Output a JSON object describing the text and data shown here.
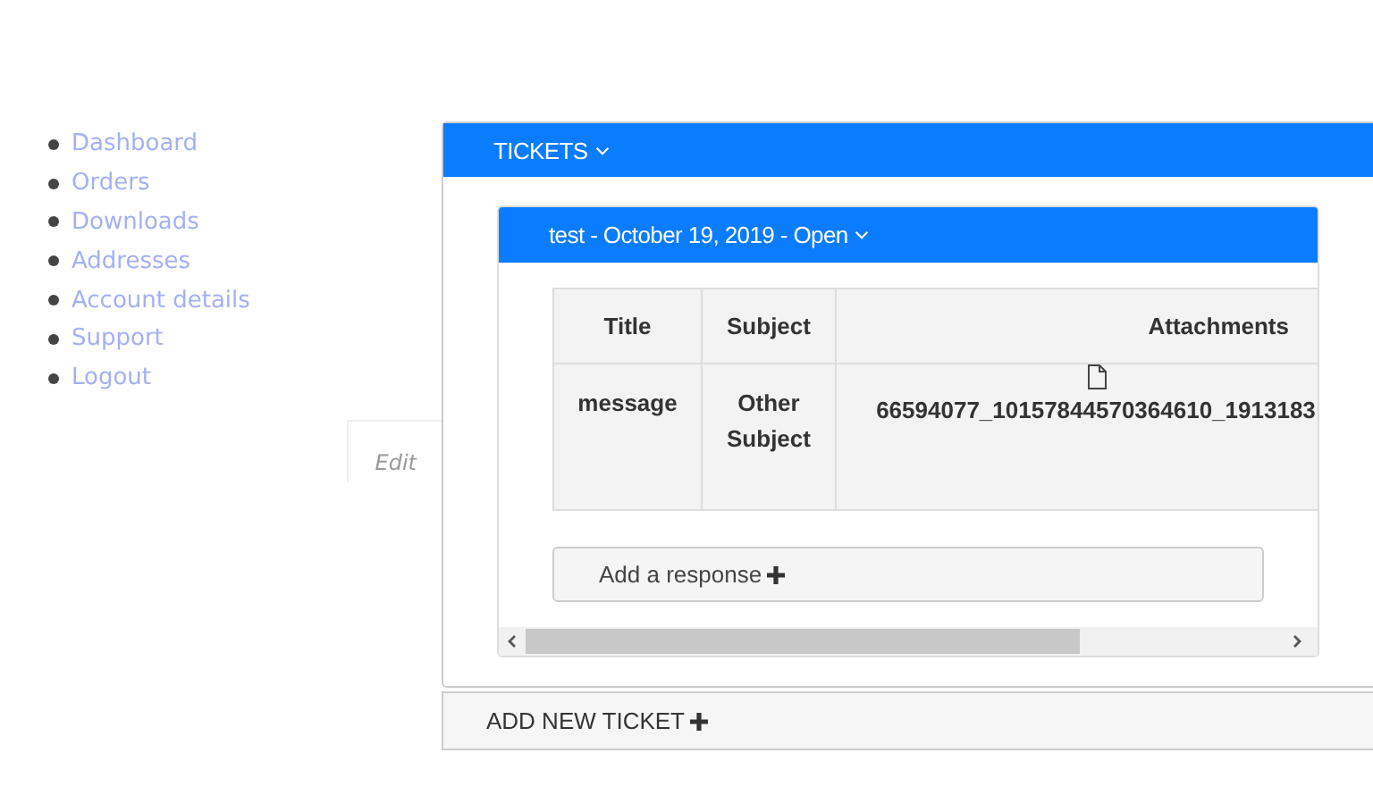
{
  "nav": {
    "items": [
      {
        "label": "Dashboard"
      },
      {
        "label": "Orders"
      },
      {
        "label": "Downloads"
      },
      {
        "label": "Addresses"
      },
      {
        "label": "Account details"
      },
      {
        "label": "Support"
      },
      {
        "label": "Logout"
      }
    ]
  },
  "edit_tab": {
    "label": "Edit"
  },
  "tickets": {
    "title": "TICKETS",
    "expanded": true,
    "ticket": {
      "title": "test - October 19, 2019 - Open",
      "expanded": true,
      "table": {
        "columns": [
          "Title",
          "Subject",
          "Attachments"
        ],
        "rows": [
          {
            "title": "message",
            "subject": "Other Subject",
            "attachment": "66594077_10157844570364610_1913183"
          }
        ]
      },
      "response_button": "Add a response"
    }
  },
  "add_ticket_button": "ADD NEW TICKET"
}
